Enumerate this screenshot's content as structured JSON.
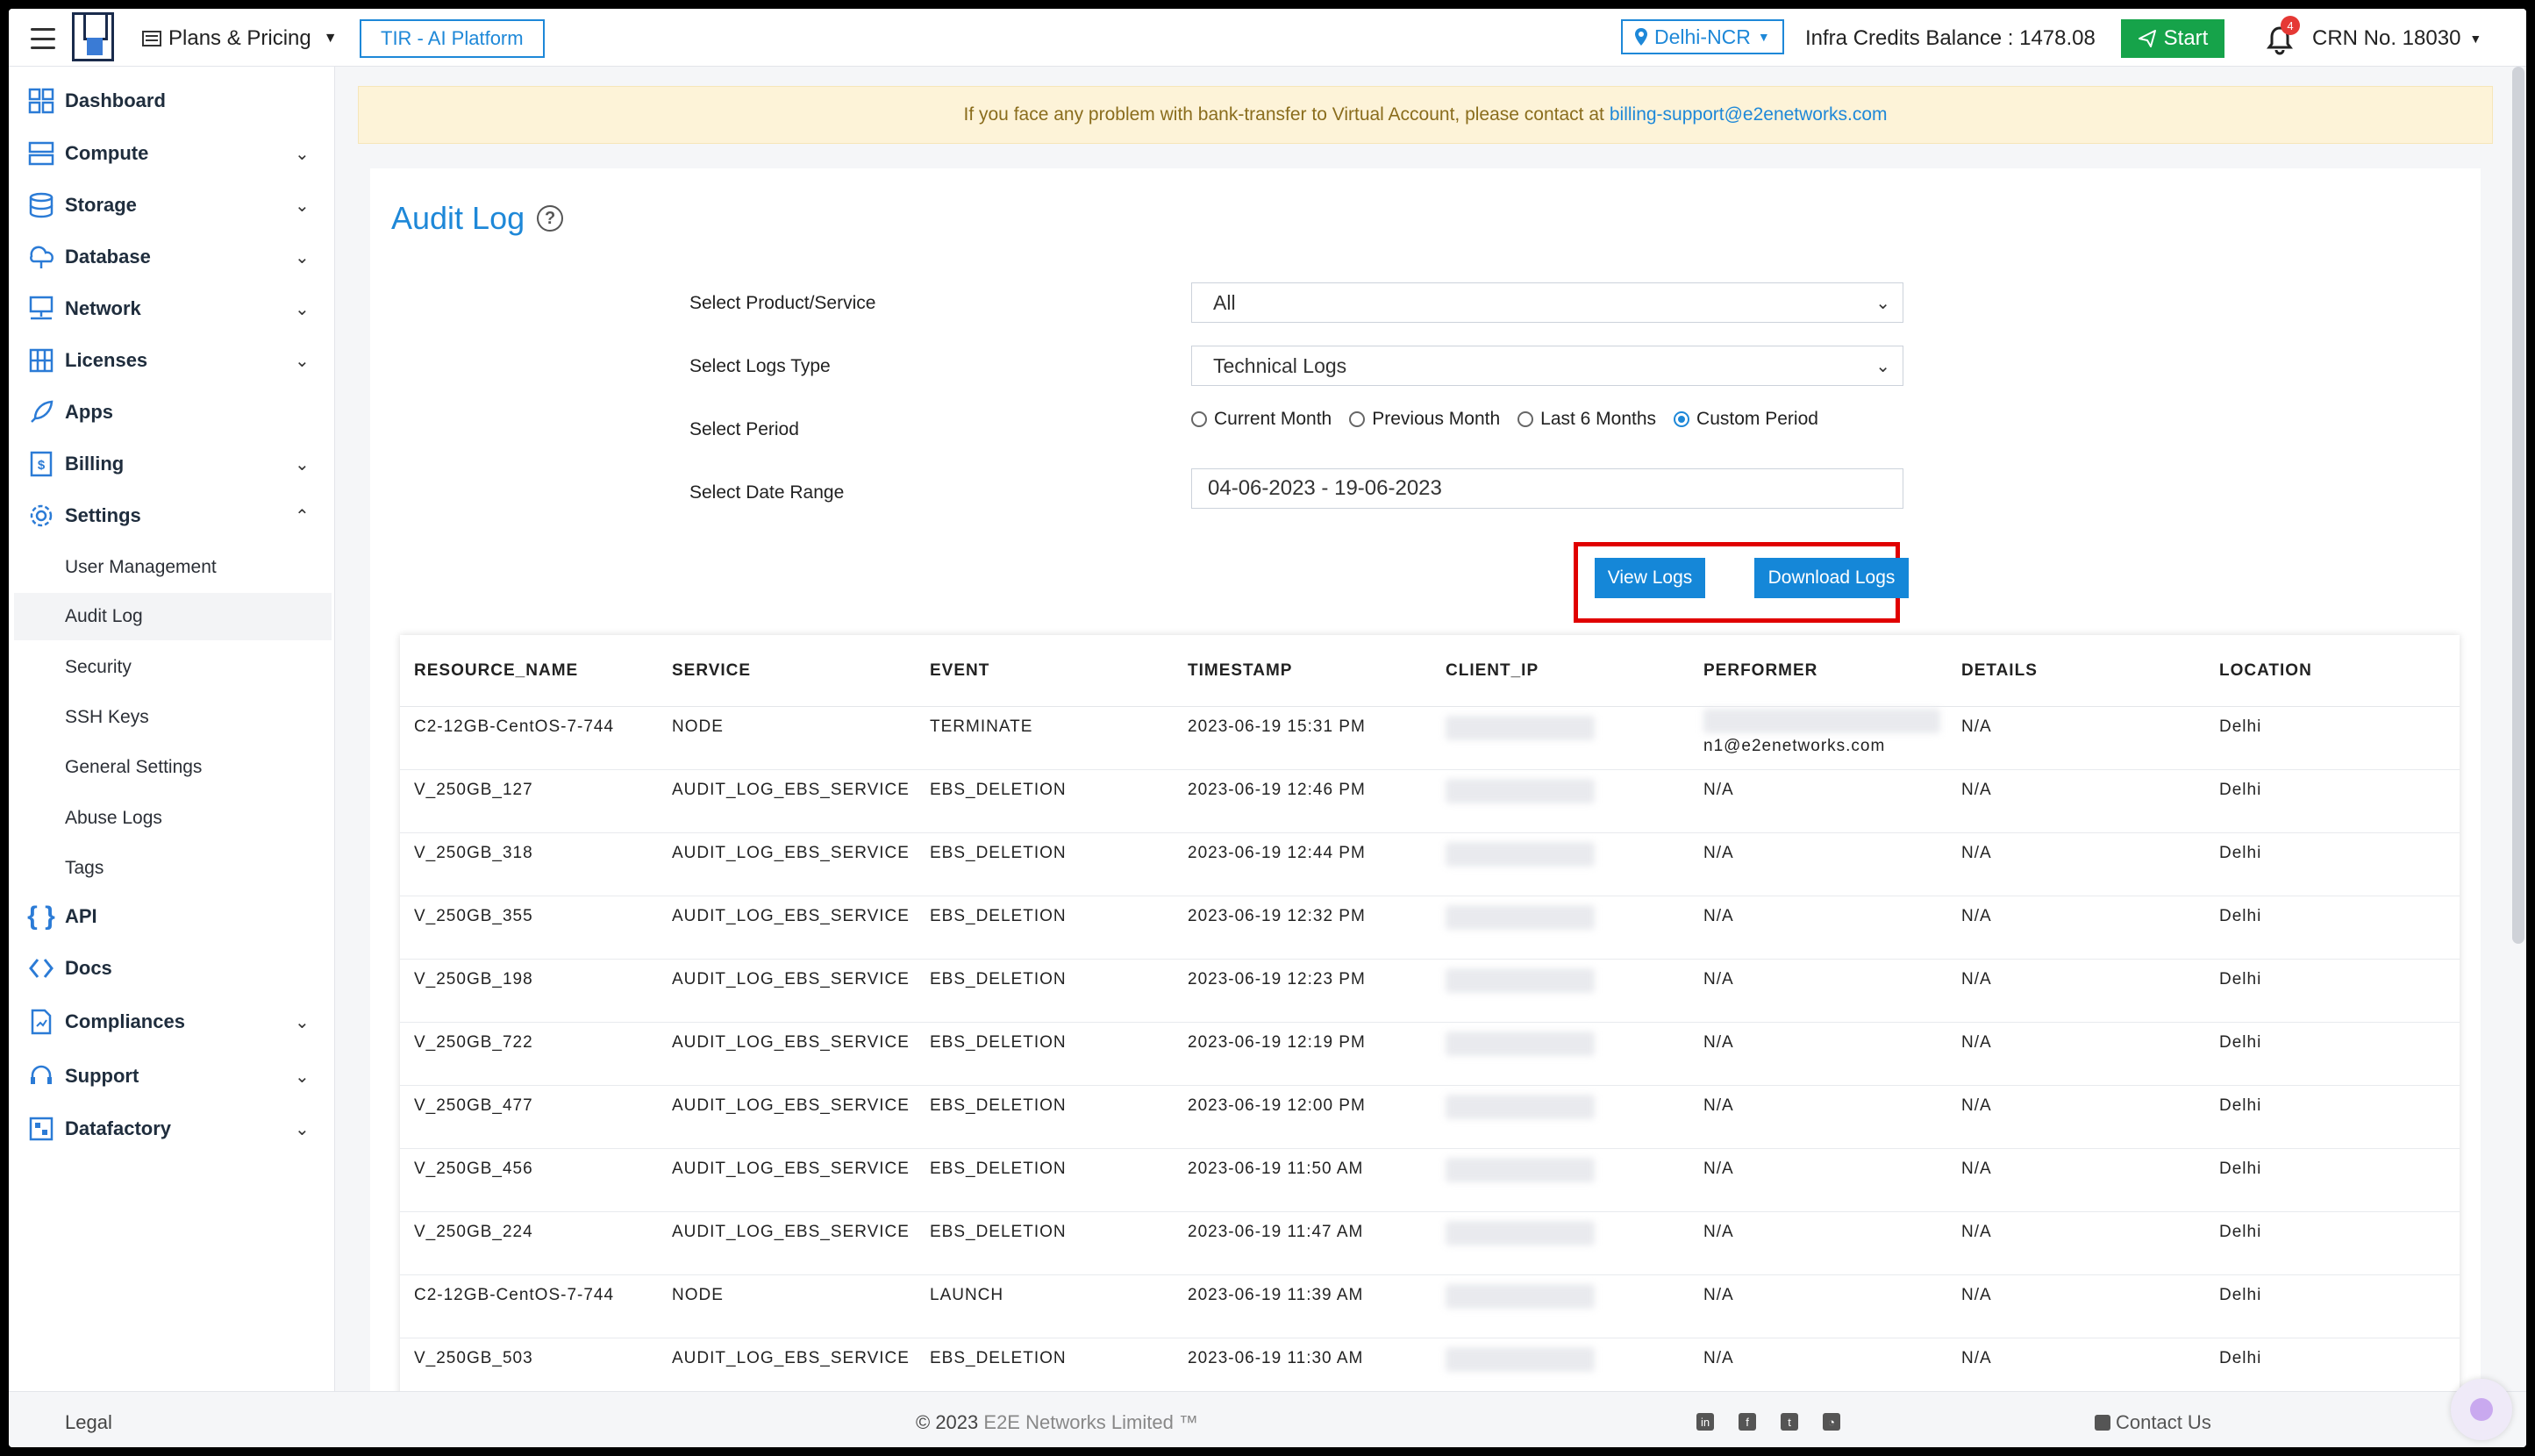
{
  "topbar": {
    "plans_label": "Plans & Pricing",
    "tir_label": "TIR - AI Platform",
    "region_label": "Delhi-NCR",
    "credits_label": "Infra Credits Balance : 1478.08",
    "start_label": "Start",
    "notification_count": "4",
    "crn_label": "CRN No. 18030"
  },
  "sidebar": {
    "items": [
      {
        "label": "Dashboard"
      },
      {
        "label": "Compute"
      },
      {
        "label": "Storage"
      },
      {
        "label": "Database"
      },
      {
        "label": "Network"
      },
      {
        "label": "Licenses"
      },
      {
        "label": "Apps"
      },
      {
        "label": "Billing"
      },
      {
        "label": "Settings"
      },
      {
        "label": "API"
      },
      {
        "label": "Docs"
      },
      {
        "label": "Compliances"
      },
      {
        "label": "Support"
      },
      {
        "label": "Datafactory"
      }
    ],
    "settings_sub": [
      {
        "label": "User Management"
      },
      {
        "label": "Audit Log"
      },
      {
        "label": "Security"
      },
      {
        "label": "SSH Keys"
      },
      {
        "label": "General Settings"
      },
      {
        "label": "Abuse Logs"
      },
      {
        "label": "Tags"
      }
    ]
  },
  "alert": {
    "text": "If you face any problem with bank-transfer to Virtual Account, please contact at",
    "link": "billing-support@e2enetworks.com"
  },
  "page": {
    "title": "Audit Log",
    "help_glyph": "?"
  },
  "form": {
    "product_label": "Select Product/Service",
    "product_value": "All",
    "logs_type_label": "Select Logs Type",
    "logs_type_value": "Technical Logs",
    "period_label": "Select Period",
    "period_options": [
      "Current Month",
      "Previous Month",
      "Last 6 Months",
      "Custom Period"
    ],
    "period_selected": "Custom Period",
    "date_range_label": "Select Date Range",
    "date_range_value": "04-06-2023 - 19-06-2023",
    "view_logs_label": "View Logs",
    "download_logs_label": "Download Logs"
  },
  "table": {
    "columns": [
      "RESOURCE_NAME",
      "SERVICE",
      "EVENT",
      "TIMESTAMP",
      "CLIENT_IP",
      "PERFORMER",
      "DETAILS",
      "LOCATION"
    ],
    "rows": [
      {
        "resource": "C2-12GB-CentOS-7-744",
        "service": "NODE",
        "event": "TERMINATE",
        "timestamp": "2023-06-19 15:31 PM",
        "performer": "n1@e2enetworks.com",
        "details": "N/A",
        "location": "Delhi"
      },
      {
        "resource": "V_250GB_127",
        "service": "AUDIT_LOG_EBS_SERVICE",
        "event": "EBS_DELETION",
        "timestamp": "2023-06-19 12:46 PM",
        "performer": "N/A",
        "details": "N/A",
        "location": "Delhi"
      },
      {
        "resource": "V_250GB_318",
        "service": "AUDIT_LOG_EBS_SERVICE",
        "event": "EBS_DELETION",
        "timestamp": "2023-06-19 12:44 PM",
        "performer": "N/A",
        "details": "N/A",
        "location": "Delhi"
      },
      {
        "resource": "V_250GB_355",
        "service": "AUDIT_LOG_EBS_SERVICE",
        "event": "EBS_DELETION",
        "timestamp": "2023-06-19 12:32 PM",
        "performer": "N/A",
        "details": "N/A",
        "location": "Delhi"
      },
      {
        "resource": "V_250GB_198",
        "service": "AUDIT_LOG_EBS_SERVICE",
        "event": "EBS_DELETION",
        "timestamp": "2023-06-19 12:23 PM",
        "performer": "N/A",
        "details": "N/A",
        "location": "Delhi"
      },
      {
        "resource": "V_250GB_722",
        "service": "AUDIT_LOG_EBS_SERVICE",
        "event": "EBS_DELETION",
        "timestamp": "2023-06-19 12:19 PM",
        "performer": "N/A",
        "details": "N/A",
        "location": "Delhi"
      },
      {
        "resource": "V_250GB_477",
        "service": "AUDIT_LOG_EBS_SERVICE",
        "event": "EBS_DELETION",
        "timestamp": "2023-06-19 12:00 PM",
        "performer": "N/A",
        "details": "N/A",
        "location": "Delhi"
      },
      {
        "resource": "V_250GB_456",
        "service": "AUDIT_LOG_EBS_SERVICE",
        "event": "EBS_DELETION",
        "timestamp": "2023-06-19 11:50 AM",
        "performer": "N/A",
        "details": "N/A",
        "location": "Delhi"
      },
      {
        "resource": "V_250GB_224",
        "service": "AUDIT_LOG_EBS_SERVICE",
        "event": "EBS_DELETION",
        "timestamp": "2023-06-19 11:47 AM",
        "performer": "N/A",
        "details": "N/A",
        "location": "Delhi"
      },
      {
        "resource": "C2-12GB-CentOS-7-744",
        "service": "NODE",
        "event": "LAUNCH",
        "timestamp": "2023-06-19 11:39 AM",
        "performer": "N/A",
        "details": "N/A",
        "location": "Delhi"
      },
      {
        "resource": "V_250GB_503",
        "service": "AUDIT_LOG_EBS_SERVICE",
        "event": "EBS_DELETION",
        "timestamp": "2023-06-19 11:30 AM",
        "performer": "N/A",
        "details": "N/A",
        "location": "Delhi"
      }
    ]
  },
  "footer": {
    "legal": "Legal",
    "copyright_prefix": "© 2023",
    "copyright_brand": "E2E Networks Limited ™",
    "contact": "Contact Us",
    "social_icons": [
      "linkedin-icon",
      "facebook-icon",
      "twitter-icon",
      "rss-icon"
    ]
  },
  "colors": {
    "accent": "#1e88d8",
    "start_button": "#16a34a",
    "highlight_box": "#e00000",
    "alert_bg": "#fdf3d8"
  }
}
